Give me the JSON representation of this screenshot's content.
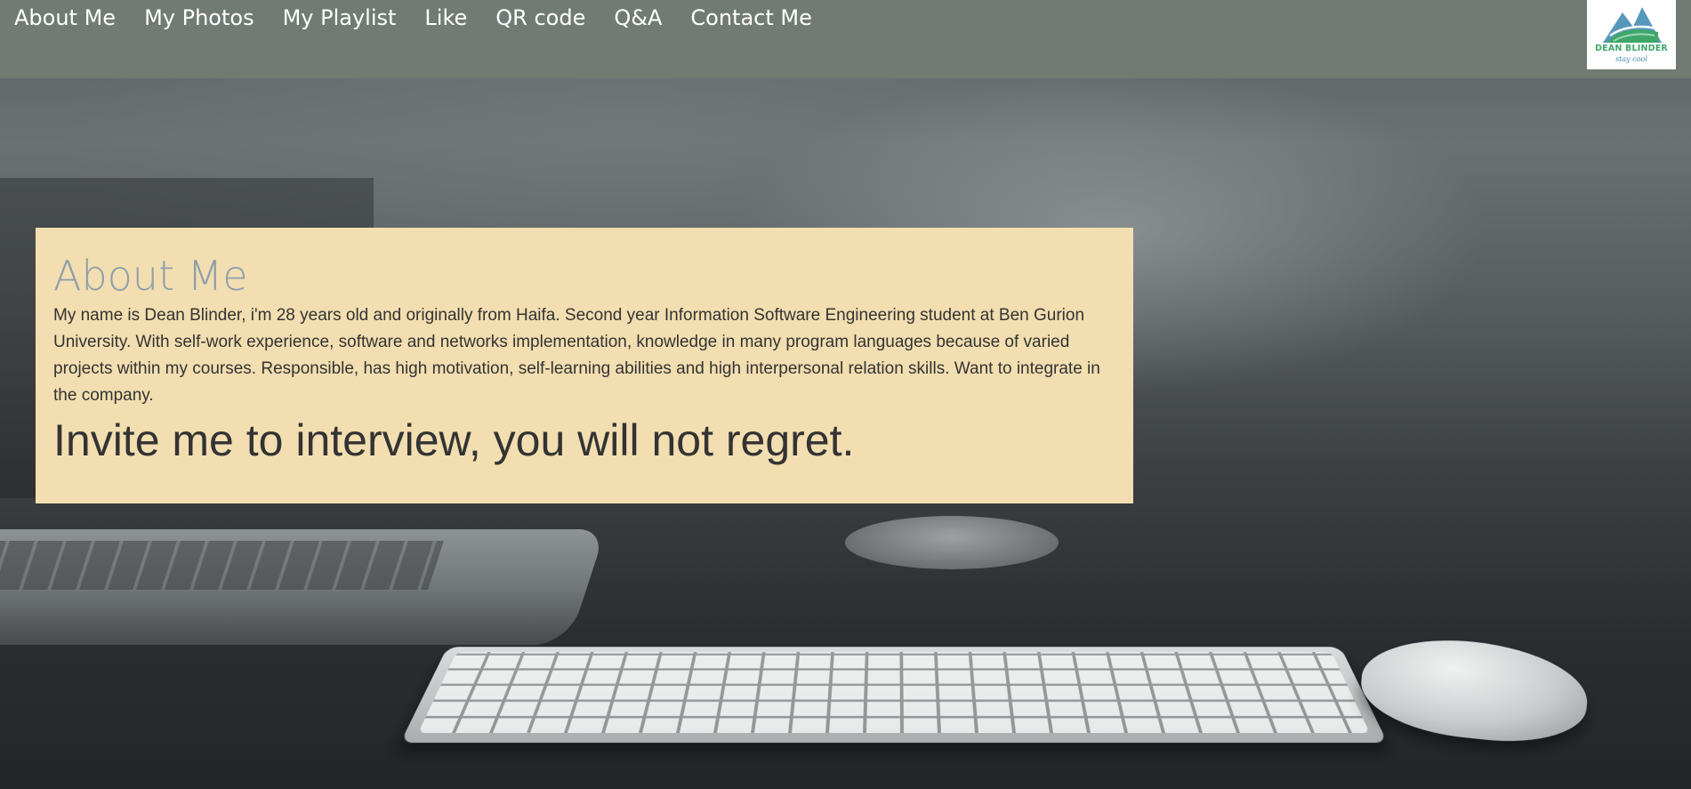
{
  "nav": {
    "items": [
      {
        "label": "About Me"
      },
      {
        "label": "My Photos"
      },
      {
        "label": "My Playlist"
      },
      {
        "label": "Like"
      },
      {
        "label": "QR code"
      },
      {
        "label": "Q&A"
      },
      {
        "label": "Contact Me"
      }
    ]
  },
  "logo": {
    "name": "DEAN BLINDER",
    "tagline": "stay cool",
    "icon": "mountain-wave-logo-icon",
    "colors": {
      "green": "#3fa66a",
      "blue": "#3b86b0"
    }
  },
  "about": {
    "title": "About Me",
    "text": "My name is Dean Blinder, i'm 28 years old and originally from Haifa. Second year Information Software Engineering student at Ben Gurion University. With self-work experience, software and networks implementation, knowledge in many program languages because of varied projects within my courses. Responsible, has high motivation, self-learning abilities and high interpersonal relation skills. Want to integrate in the company.",
    "cta": "Invite me to interview, you will not regret."
  },
  "colors": {
    "header_bg": "#717b74",
    "panel_bg": "#f2deb0",
    "title_color": "#8e9eac",
    "text_color": "#333333"
  },
  "background": {
    "icon": "desk-keyboard-photo"
  }
}
